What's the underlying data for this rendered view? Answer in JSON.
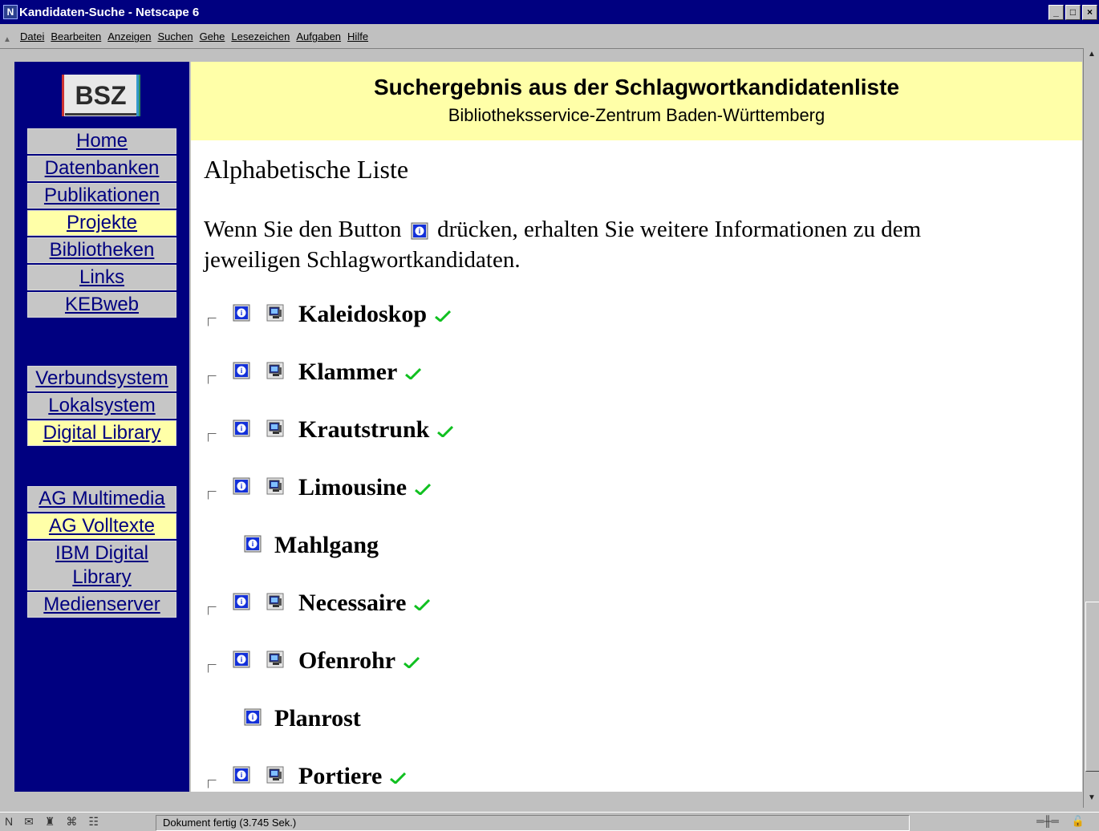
{
  "window": {
    "title": "Kandidaten-Suche - Netscape 6"
  },
  "menu": {
    "items": [
      "Datei",
      "Bearbeiten",
      "Anzeigen",
      "Suchen",
      "Gehe",
      "Lesezeichen",
      "Aufgaben",
      "Hilfe"
    ]
  },
  "sidebar": {
    "logo": "BSZ",
    "items": [
      {
        "label": "Home",
        "active": false
      },
      {
        "label": "Datenbanken",
        "active": false
      },
      {
        "label": "Publikationen",
        "active": false
      },
      {
        "label": "Projekte",
        "active": true
      },
      {
        "label": "Bibliotheken",
        "active": false
      },
      {
        "label": "Links",
        "active": false
      },
      {
        "label": "KEBweb",
        "active": false
      },
      {
        "label": "Verbundsystem",
        "active": false
      },
      {
        "label": "Lokalsystem",
        "active": false
      },
      {
        "label": "Digital Library",
        "active": true
      },
      {
        "label": "AG Multimedia",
        "active": false
      },
      {
        "label": "AG Volltexte",
        "active": true
      },
      {
        "label": "IBM Digital Library",
        "active": false
      },
      {
        "label": "Medienserver",
        "active": false
      }
    ]
  },
  "header": {
    "title": "Suchergebnis aus der Schlagwortkandidatenliste",
    "subtitle": "Bibliotheksservice-Zentrum Baden-Württemberg"
  },
  "main": {
    "section_title": "Alphabetische Liste",
    "intro_before": "Wenn Sie den Button",
    "intro_after": "drücken, erhalten Sie weitere Informationen zu dem jeweiligen Schlagwortkandidaten.",
    "entries": [
      {
        "term": "Kaleidoskop",
        "selectable": true
      },
      {
        "term": "Klammer",
        "selectable": true
      },
      {
        "term": "Krautstrunk",
        "selectable": true
      },
      {
        "term": "Limousine",
        "selectable": true
      },
      {
        "term": "Mahlgang",
        "selectable": false
      },
      {
        "term": "Necessaire",
        "selectable": true
      },
      {
        "term": "Ofenrohr",
        "selectable": true
      },
      {
        "term": "Planrost",
        "selectable": false
      },
      {
        "term": "Portiere",
        "selectable": true
      }
    ]
  },
  "status": {
    "text": "Dokument fertig (3.745 Sek.)"
  }
}
